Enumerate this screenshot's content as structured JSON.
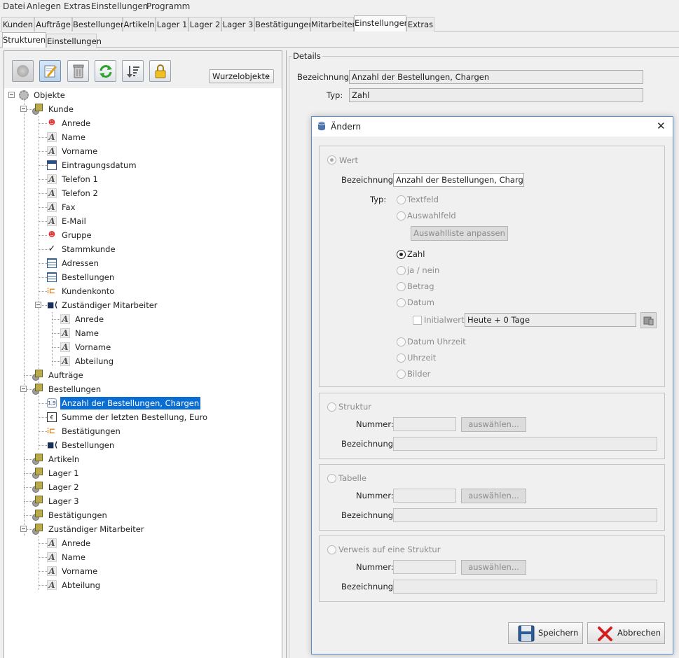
{
  "menubar": [
    "Datei",
    "Anlegen",
    "Extras",
    "Einstellungen",
    "Programm"
  ],
  "main_tabs": [
    "Kunden",
    "Aufträge",
    "Bestellungen",
    "Artikeln",
    "Lager 1",
    "Lager 2",
    "Lager 3",
    "Bestätigungen",
    "Mitarbeiter",
    "Einstellungen",
    "Extras"
  ],
  "main_tab_active": "Einstellungen",
  "sub_tabs": [
    "Strukturen",
    "Einstellungen"
  ],
  "sub_tab_active": "Strukturen",
  "toolbar": {
    "icons": [
      "new-icon",
      "edit-icon",
      "delete-icon",
      "refresh-icon",
      "sort-icon",
      "lock-icon"
    ],
    "root_combo": "Wurzelobjekte"
  },
  "tree": {
    "root": "Objekte",
    "nodes": [
      {
        "label": "Kunde",
        "icon": "folder-icon"
      },
      {
        "label": "Anrede",
        "icon": "mask-icon"
      },
      {
        "label": "Name",
        "icon": "text-icon"
      },
      {
        "label": "Vorname",
        "icon": "text-icon"
      },
      {
        "label": "Eintragungsdatum",
        "icon": "calendar-icon"
      },
      {
        "label": "Telefon 1",
        "icon": "text-icon"
      },
      {
        "label": "Telefon 2",
        "icon": "text-icon"
      },
      {
        "label": "Fax",
        "icon": "text-icon"
      },
      {
        "label": "E-Mail",
        "icon": "text-icon"
      },
      {
        "label": "Gruppe",
        "icon": "mask-icon"
      },
      {
        "label": "Stammkunde",
        "icon": "check-icon"
      },
      {
        "label": "Adressen",
        "icon": "table-icon"
      },
      {
        "label": "Bestellungen",
        "icon": "table-icon"
      },
      {
        "label": "Kundenkonto",
        "icon": "branch-icon"
      },
      {
        "label": "Zuständiger Mitarbeiter",
        "icon": "link-icon"
      },
      {
        "label": "Anrede",
        "icon": "text-icon"
      },
      {
        "label": "Name",
        "icon": "text-icon"
      },
      {
        "label": "Vorname",
        "icon": "text-icon"
      },
      {
        "label": "Abteilung",
        "icon": "text-icon"
      },
      {
        "label": "Aufträge",
        "icon": "folder-icon"
      },
      {
        "label": "Bestellungen",
        "icon": "folder-icon"
      },
      {
        "label": "Anzahl der Bestellungen, Chargen",
        "icon": "number-icon",
        "selected": true
      },
      {
        "label": "Summe der letzten Bestellung, Euro",
        "icon": "money-icon"
      },
      {
        "label": "Bestätigungen",
        "icon": "branch-icon"
      },
      {
        "label": "Bestellungen",
        "icon": "link-icon"
      },
      {
        "label": "Artikeln",
        "icon": "folder-icon"
      },
      {
        "label": "Lager 1",
        "icon": "folder-icon"
      },
      {
        "label": "Lager 2",
        "icon": "folder-icon"
      },
      {
        "label": "Lager 3",
        "icon": "folder-icon"
      },
      {
        "label": "Bestätigungen",
        "icon": "folder-icon"
      },
      {
        "label": "Zuständiger Mitarbeiter",
        "icon": "folder-icon"
      },
      {
        "label": "Anrede",
        "icon": "text-icon"
      },
      {
        "label": "Name",
        "icon": "text-icon"
      },
      {
        "label": "Vorname",
        "icon": "text-icon"
      },
      {
        "label": "Abteilung",
        "icon": "text-icon"
      }
    ]
  },
  "details": {
    "title": "Details",
    "bezeichnung_label": "Bezeichnung:",
    "bezeichnung_value": "Anzahl der Bestellungen, Chargen",
    "typ_label": "Typ:",
    "typ_value": "Zahl"
  },
  "dialog": {
    "title": "Ändern",
    "close": "✕",
    "wert": {
      "radio_label": "Wert",
      "bezeichnung_label": "Bezeichnung:",
      "bezeichnung_value": "Anzahl der Bestellungen, Chargen",
      "typ_label": "Typ:",
      "types": [
        "Textfeld",
        "Auswahlfeld",
        "Zahl",
        "ja / nein",
        "Betrag",
        "Datum",
        "Datum Uhrzeit",
        "Uhrzeit",
        "Bilder"
      ],
      "selected_type": "Zahl",
      "auswahlliste_button": "Auswahlliste anpassen",
      "initialwert_label": "Initialwert:",
      "initialwert_value": "Heute + 0 Tage"
    },
    "struktur": {
      "radio_label": "Struktur",
      "nummer_label": "Nummer:",
      "choose_button": "auswählen...",
      "bezeichnung_label": "Bezeichnung:"
    },
    "tabelle": {
      "radio_label": "Tabelle",
      "nummer_label": "Nummer:",
      "choose_button": "auswählen...",
      "bezeichnung_label": "Bezeichnung:"
    },
    "verweis": {
      "radio_label": "Verweis auf eine Struktur",
      "nummer_label": "Nummer:",
      "choose_button": "auswählen...",
      "bezeichnung_label": "Bezeichnung:"
    },
    "save_button": "Speichern",
    "cancel_button": "Abbrechen"
  }
}
